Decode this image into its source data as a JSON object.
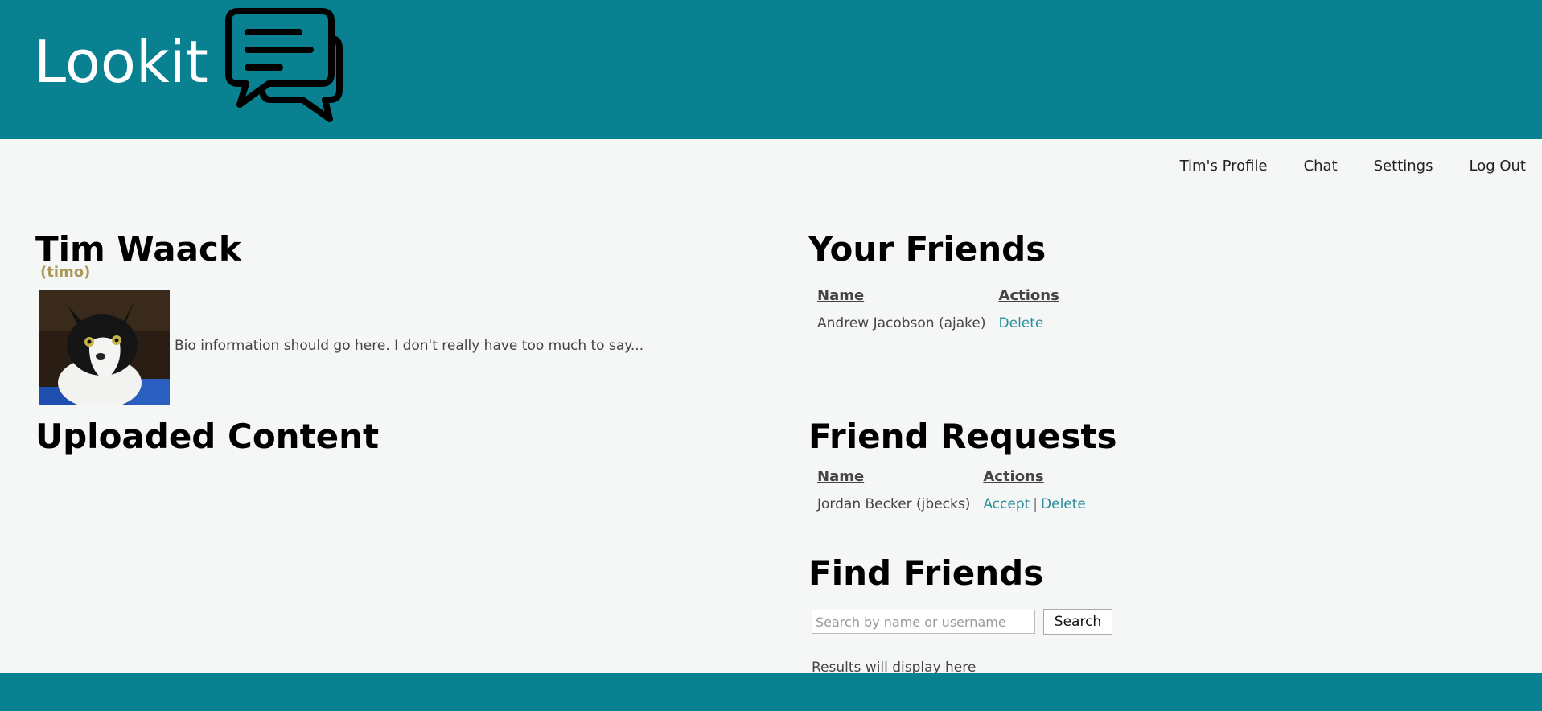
{
  "header": {
    "brand": "Lookit",
    "logo_icon": "chat-bubbles-icon",
    "background_color": "#0a8191"
  },
  "nav": {
    "profile": "Tim's Profile",
    "chat": "Chat",
    "settings": "Settings",
    "logout": "Log Out"
  },
  "profile": {
    "name": "Tim Waack",
    "username": "(timo)",
    "bio": "Bio information should go here. I don't really have too much to say...",
    "avatar_icon": "cat-photo",
    "uploaded_title": "Uploaded Content"
  },
  "friends": {
    "title": "Your Friends",
    "columns": [
      "Name",
      "Actions"
    ],
    "rows": [
      {
        "name": "Andrew Jacobson (ajake)",
        "delete": "Delete"
      }
    ]
  },
  "requests": {
    "title": "Friend Requests",
    "columns": [
      "Name",
      "Actions"
    ],
    "rows": [
      {
        "name": "Jordan Becker (jbecks)",
        "accept": "Accept",
        "separator": "|",
        "delete": "Delete"
      }
    ]
  },
  "find": {
    "title": "Find Friends",
    "placeholder": "Search by name or username",
    "button": "Search",
    "results": "Results will display here"
  },
  "colors": {
    "accent": "#0a8191",
    "link": "#2a8f9b",
    "username": "#a99a5a"
  }
}
